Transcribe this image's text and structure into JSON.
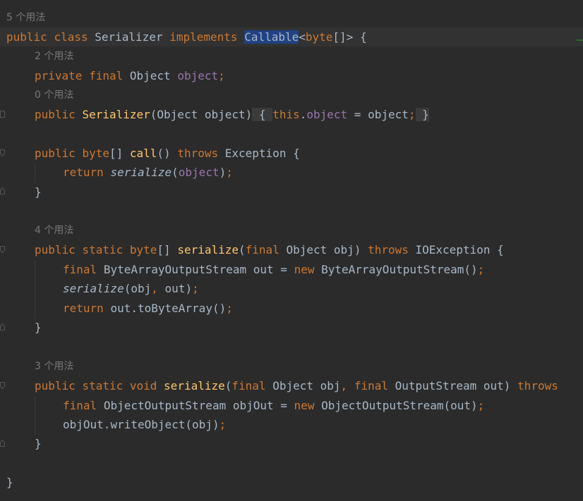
{
  "editor": {
    "usage_hints": {
      "class": "5 个用法",
      "field": "2 个用法",
      "constructor": "0 个用法",
      "serialize_bytes": "4 个用法",
      "serialize_stream": "3 个用法"
    },
    "tokens": {
      "public": "public",
      "class": "class",
      "private": "private",
      "final": "final",
      "static": "static",
      "void": "void",
      "return": "return",
      "throws": "throws",
      "new": "new",
      "this": "this",
      "implements": "implements",
      "byte": "byte",
      "Serializer": "Serializer",
      "Callable": "Callable",
      "Object": "Object",
      "object": "object",
      "call": "call",
      "Exception": "Exception",
      "serialize": "serialize",
      "obj": "obj",
      "IOException": "IOException",
      "ByteArrayOutputStream": "ByteArrayOutputStream",
      "out": "out",
      "toByteArray": "toByteArray",
      "OutputStream": "OutputStream",
      "ObjectOutputStream": "ObjectOutputStream",
      "objOut": "objOut",
      "writeObject": "writeObject"
    }
  },
  "colors": {
    "background": "#2b2b2b",
    "keyword": "#cc7832",
    "function": "#ffc66d",
    "field": "#9876aa",
    "text": "#a9b7c6",
    "hint": "#787878",
    "selection": "#214283"
  }
}
